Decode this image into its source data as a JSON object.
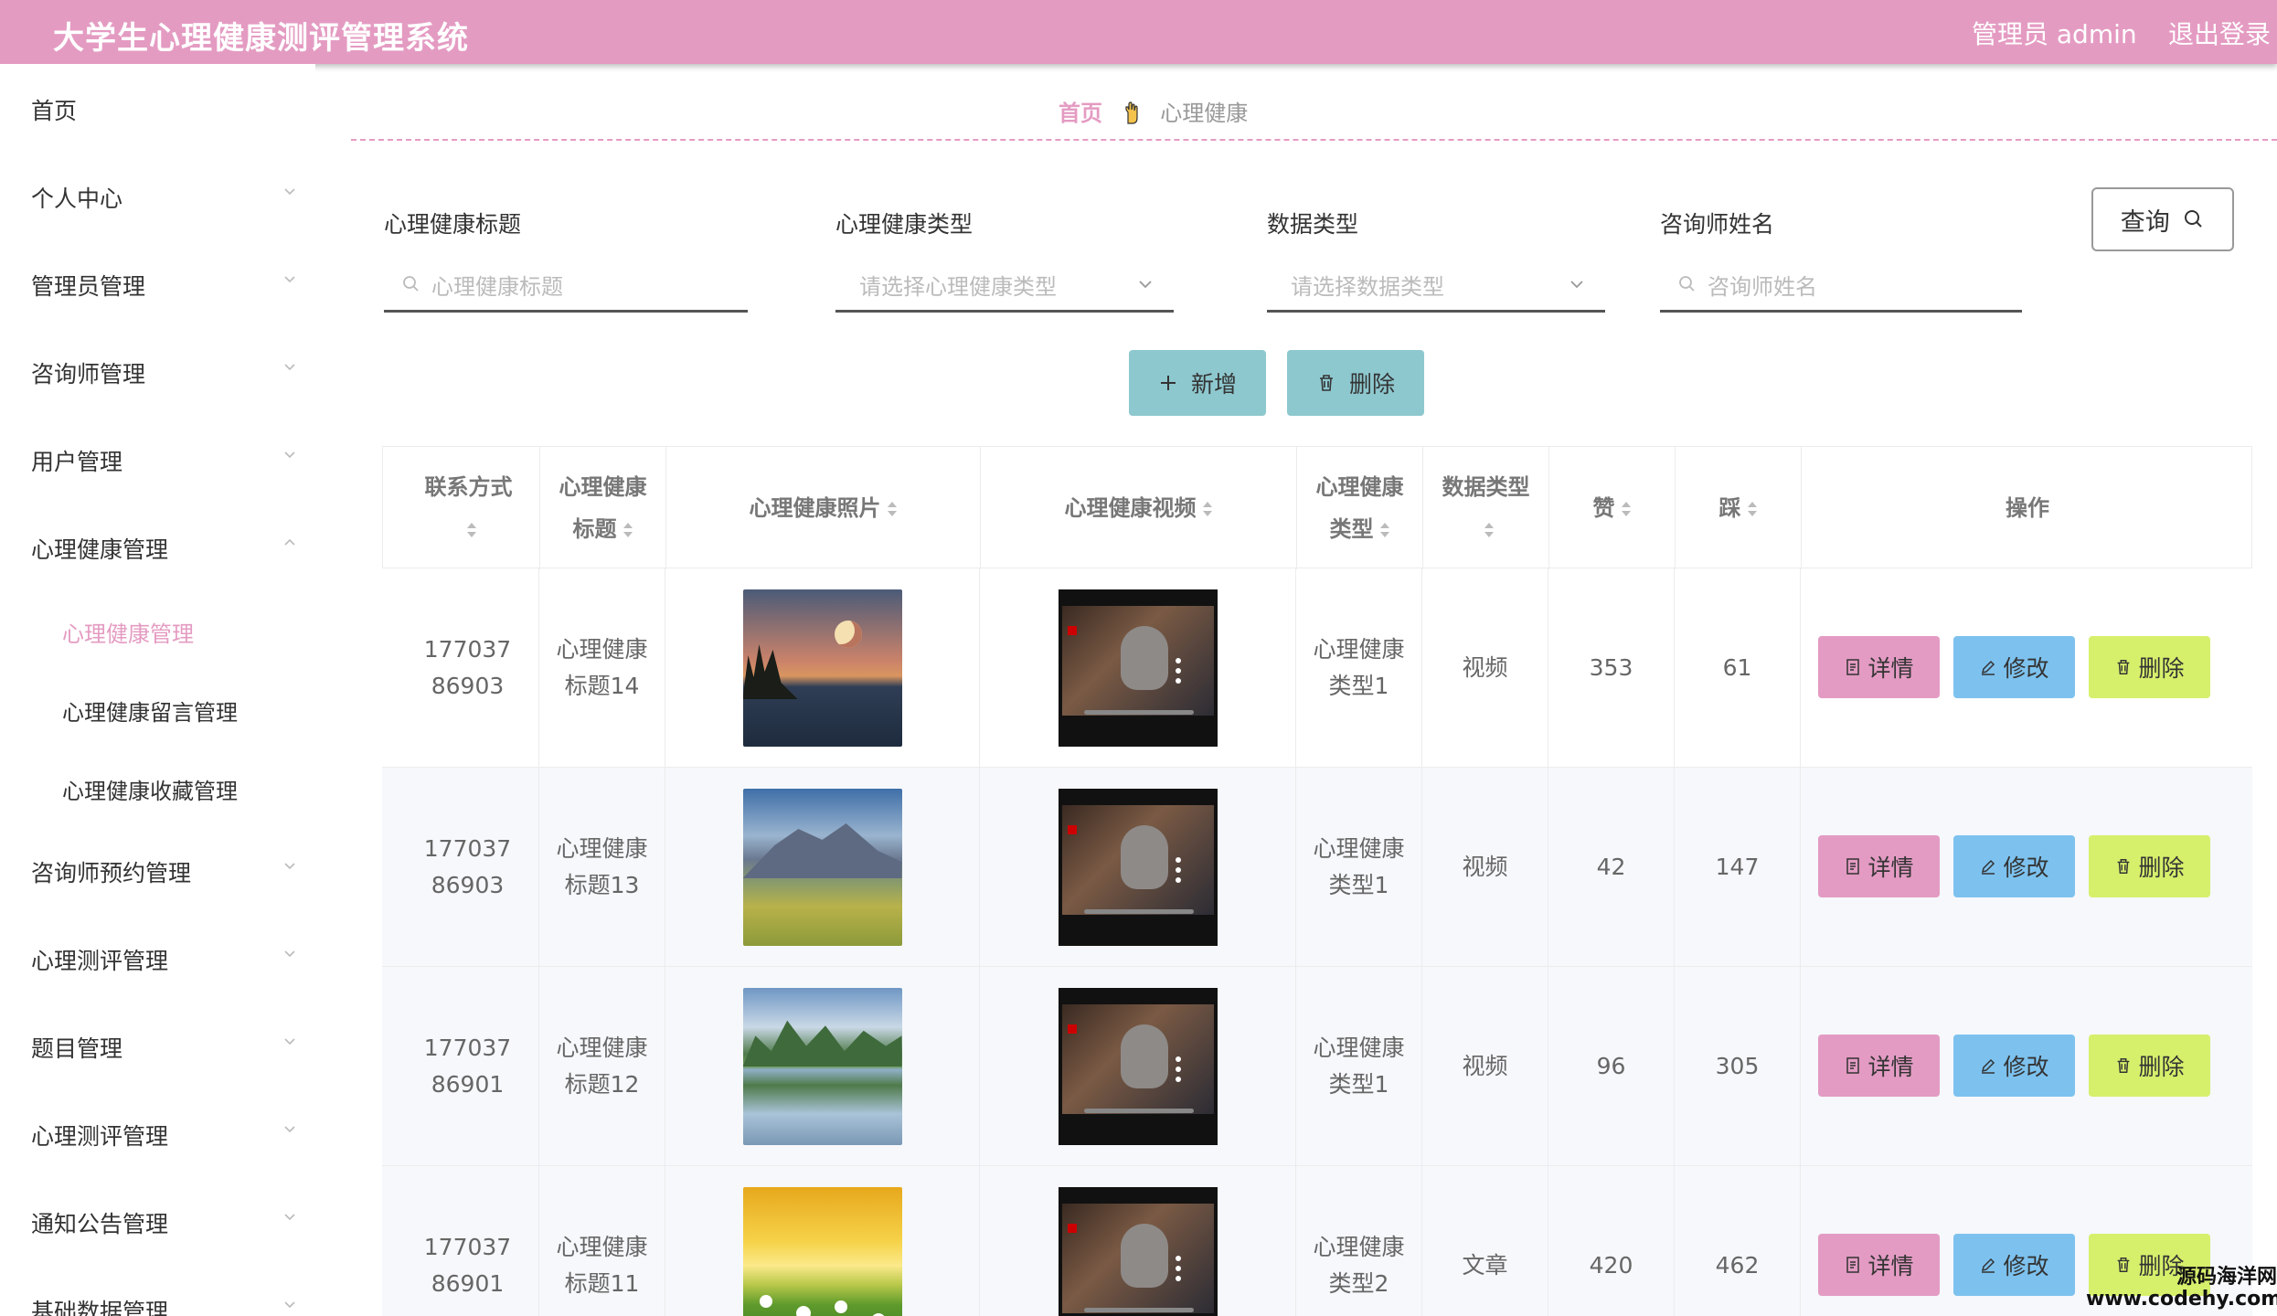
{
  "header": {
    "title": "大学生心理健康测评管理系统",
    "user": "管理员 admin",
    "logout": "退出登录"
  },
  "sidebar": {
    "items": [
      {
        "label": "首页"
      },
      {
        "label": "个人中心"
      },
      {
        "label": "管理员管理"
      },
      {
        "label": "咨询师管理"
      },
      {
        "label": "用户管理"
      },
      {
        "label": "心理健康管理"
      },
      {
        "label": "咨询师预约管理"
      },
      {
        "label": "心理测评管理"
      },
      {
        "label": "题目管理"
      },
      {
        "label": "心理测评管理"
      },
      {
        "label": "通知公告管理"
      },
      {
        "label": "基础数据管理"
      }
    ],
    "sub_items": [
      {
        "label": "心理健康管理"
      },
      {
        "label": "心理健康留言管理"
      },
      {
        "label": "心理健康收藏管理"
      }
    ]
  },
  "breadcrumb": {
    "home": "首页",
    "current": "心理健康"
  },
  "search": {
    "title_label": "心理健康标题",
    "title_placeholder": "心理健康标题",
    "type_label": "心理健康类型",
    "type_placeholder": "请选择心理健康类型",
    "data_type_label": "数据类型",
    "data_type_placeholder": "请选择数据类型",
    "counselor_label": "咨询师姓名",
    "counselor_placeholder": "咨询师姓名",
    "query_label": "查询"
  },
  "actions": {
    "add_label": "新增",
    "delete_label": "删除"
  },
  "table": {
    "headers": {
      "contact": "联系方式",
      "title": "心理健康标题",
      "photo": "心理健康照片",
      "video": "心理健康视频",
      "type": "心理健康类型",
      "data_type": "数据类型",
      "likes": "赞",
      "dislikes": "踩",
      "ops": "操作"
    },
    "rows": [
      {
        "contact": "17703786903",
        "title": "心理健康标题14",
        "type": "心理健康类型1",
        "data_type": "视频",
        "likes": "353",
        "dislikes": "61"
      },
      {
        "contact": "17703786903",
        "title": "心理健康标题13",
        "type": "心理健康类型1",
        "data_type": "视频",
        "likes": "42",
        "dislikes": "147"
      },
      {
        "contact": "17703786901",
        "title": "心理健康标题12",
        "type": "心理健康类型1",
        "data_type": "视频",
        "likes": "96",
        "dislikes": "305"
      },
      {
        "contact": "17703786901",
        "title": "心理健康标题11",
        "type": "心理健康类型2",
        "data_type": "文章",
        "likes": "420",
        "dislikes": "462"
      }
    ],
    "op_labels": {
      "detail": "详情",
      "edit": "修改",
      "delete": "删除"
    }
  },
  "watermark": {
    "line1": "源码海洋网",
    "line2": "www.codehy.com"
  }
}
